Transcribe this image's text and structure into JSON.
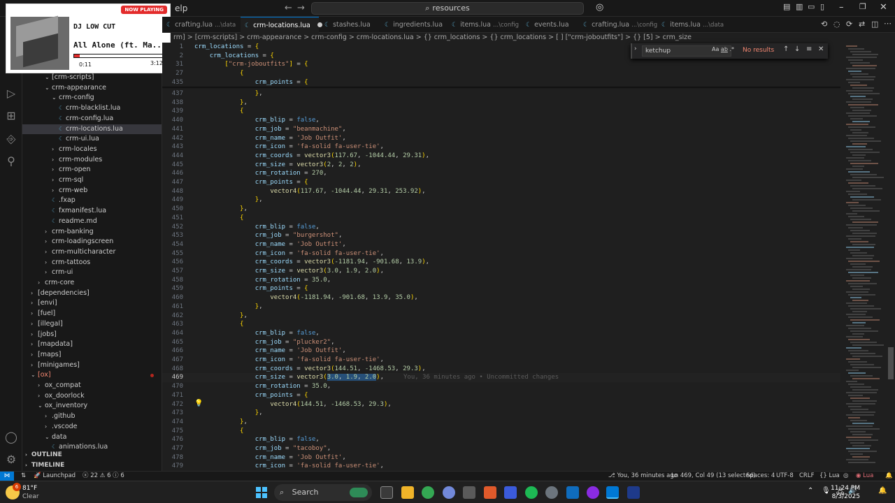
{
  "title_bar": {
    "menu_text": "elp",
    "command_center": "resources"
  },
  "now_playing": {
    "badge": "NOW PLAYING",
    "artist": "DJ LOW CUT",
    "song": "All Alone (ft. Ma...",
    "elapsed": "0:11",
    "duration": "3:12",
    "progress": 0.06
  },
  "tabs": [
    {
      "label": "crafting.lua",
      "desc": "...\\data",
      "active": false
    },
    {
      "label": "crm-locations.lua",
      "desc": "",
      "active": true,
      "modified": true
    },
    {
      "label": "stashes.lua",
      "desc": "",
      "active": false
    },
    {
      "label": "ingredients.lua",
      "desc": "",
      "active": false
    },
    {
      "label": "items.lua",
      "desc": "...\\config",
      "active": false
    },
    {
      "label": "events.lua",
      "desc": "",
      "active": false
    },
    {
      "label": "crafting.lua",
      "desc": "...\\config",
      "active": false
    },
    {
      "label": "items.lua",
      "desc": "...\\data",
      "active": false
    }
  ],
  "breadcrumb": "rm] > [crm-scripts] > crm-appearance > crm-config > crm-locations.lua > {} crm_locations > {} crm_locations > [ ] [\"crm-joboutfits\"] > {} [5] > crm_size",
  "find_widget": {
    "query": "ketchup",
    "result": "No results"
  },
  "explorer": {
    "items": [
      {
        "label": "[crm-scripts]",
        "indent": 2,
        "type": "folder",
        "open": true
      },
      {
        "label": "crm-appearance",
        "indent": 2,
        "type": "folder",
        "open": true
      },
      {
        "label": "crm-config",
        "indent": 3,
        "type": "folder",
        "open": true
      },
      {
        "label": "crm-blacklist.lua",
        "indent": 4,
        "type": "file"
      },
      {
        "label": "crm-config.lua",
        "indent": 4,
        "type": "file"
      },
      {
        "label": "crm-locations.lua",
        "indent": 4,
        "type": "file",
        "selected": true
      },
      {
        "label": "crm-ui.lua",
        "indent": 4,
        "type": "file"
      },
      {
        "label": "crm-locales",
        "indent": 3,
        "type": "folder"
      },
      {
        "label": "crm-modules",
        "indent": 3,
        "type": "folder"
      },
      {
        "label": "crm-open",
        "indent": 3,
        "type": "folder"
      },
      {
        "label": "crm-sql",
        "indent": 3,
        "type": "folder"
      },
      {
        "label": "crm-web",
        "indent": 3,
        "type": "folder"
      },
      {
        "label": ".fxap",
        "indent": 3,
        "type": "file"
      },
      {
        "label": "fxmanifest.lua",
        "indent": 3,
        "type": "file"
      },
      {
        "label": "readme.md",
        "indent": 3,
        "type": "file"
      },
      {
        "label": "crm-banking",
        "indent": 2,
        "type": "folder"
      },
      {
        "label": "crm-loadingscreen",
        "indent": 2,
        "type": "folder"
      },
      {
        "label": "crm-multicharacter",
        "indent": 2,
        "type": "folder"
      },
      {
        "label": "crm-tattoos",
        "indent": 2,
        "type": "folder"
      },
      {
        "label": "crm-ui",
        "indent": 2,
        "type": "folder"
      },
      {
        "label": "crm-core",
        "indent": 1,
        "type": "folder"
      },
      {
        "label": "[dependencies]",
        "indent": 0,
        "type": "folder"
      },
      {
        "label": "[envi]",
        "indent": 0,
        "type": "folder"
      },
      {
        "label": "[fuel]",
        "indent": 0,
        "type": "folder"
      },
      {
        "label": "[illegal]",
        "indent": 0,
        "type": "folder"
      },
      {
        "label": "[jobs]",
        "indent": 0,
        "type": "folder"
      },
      {
        "label": "[mapdata]",
        "indent": 0,
        "type": "folder"
      },
      {
        "label": "[maps]",
        "indent": 0,
        "type": "folder"
      },
      {
        "label": "[minigames]",
        "indent": 0,
        "type": "folder"
      },
      {
        "label": "[ox]",
        "indent": 0,
        "type": "folder",
        "open": true,
        "red": true
      },
      {
        "label": "ox_compat",
        "indent": 1,
        "type": "folder"
      },
      {
        "label": "ox_doorlock",
        "indent": 1,
        "type": "folder"
      },
      {
        "label": "ox_inventory",
        "indent": 1,
        "type": "folder",
        "open": true
      },
      {
        "label": ".github",
        "indent": 2,
        "type": "folder"
      },
      {
        "label": ".vscode",
        "indent": 2,
        "type": "folder"
      },
      {
        "label": "data",
        "indent": 2,
        "type": "folder",
        "open": true
      },
      {
        "label": "animations.lua",
        "indent": 3,
        "type": "file"
      }
    ],
    "outline": "OUTLINE",
    "timeline": "TIMELINE"
  },
  "sticky_lines": [
    {
      "n": "1",
      "code": "crm_locations = {"
    },
    {
      "n": "2",
      "code": "    crm_locations = {"
    },
    {
      "n": "31",
      "code": "        [\"crm-joboutfits\"] = {"
    },
    {
      "n": "27",
      "code": "            {"
    },
    {
      "n": "435",
      "code": "                crm_points = {"
    }
  ],
  "code_lines": [
    {
      "n": "437",
      "code": "                },"
    },
    {
      "n": "438",
      "code": "            },"
    },
    {
      "n": "439",
      "code": "            {"
    },
    {
      "n": "440",
      "code": "                crm_blip = false,"
    },
    {
      "n": "441",
      "code": "                crm_job = \"beanmachine\","
    },
    {
      "n": "442",
      "code": "                crm_name = 'Job Outfit',"
    },
    {
      "n": "443",
      "code": "                crm_icon = 'fa-solid fa-user-tie',"
    },
    {
      "n": "444",
      "code": "                crm_coords = vector3(117.67, -1044.44, 29.31),"
    },
    {
      "n": "445",
      "code": "                crm_size = vector3(2, 2, 2),"
    },
    {
      "n": "446",
      "code": "                crm_rotation = 270,"
    },
    {
      "n": "447",
      "code": "                crm_points = {"
    },
    {
      "n": "448",
      "code": "                    vector4(117.67, -1044.44, 29.31, 253.92),"
    },
    {
      "n": "449",
      "code": "                },"
    },
    {
      "n": "450",
      "code": "            },"
    },
    {
      "n": "451",
      "code": "            {"
    },
    {
      "n": "452",
      "code": "                crm_blip = false,"
    },
    {
      "n": "453",
      "code": "                crm_job = \"burgershot\","
    },
    {
      "n": "454",
      "code": "                crm_name = 'Job Outfit',"
    },
    {
      "n": "455",
      "code": "                crm_icon = 'fa-solid fa-user-tie',"
    },
    {
      "n": "456",
      "code": "                crm_coords = vector3(-1181.94, -901.68, 13.9),"
    },
    {
      "n": "457",
      "code": "                crm_size = vector3(3.0, 1.9, 2.0),"
    },
    {
      "n": "458",
      "code": "                crm_rotation = 35.0,"
    },
    {
      "n": "459",
      "code": "                crm_points = {"
    },
    {
      "n": "460",
      "code": "                    vector4(-1181.94, -901.68, 13.9, 35.0),"
    },
    {
      "n": "461",
      "code": "                },"
    },
    {
      "n": "462",
      "code": "            },"
    },
    {
      "n": "463",
      "code": "            {"
    },
    {
      "n": "464",
      "code": "                crm_blip = false,"
    },
    {
      "n": "465",
      "code": "                crm_job = \"plucker2\","
    },
    {
      "n": "466",
      "code": "                crm_name = 'Job Outfit',"
    },
    {
      "n": "467",
      "code": "                crm_icon = 'fa-solid fa-user-tie',"
    },
    {
      "n": "468",
      "code": "                crm_coords = vector3(144.51, -1468.53, 29.3),"
    },
    {
      "n": "469",
      "code": "                crm_size = vector3(3.0, 1.9, 2.0),",
      "current": true,
      "blame": "You, 36 minutes ago • Uncommitted changes"
    },
    {
      "n": "470",
      "code": "                crm_rotation = 35.0,"
    },
    {
      "n": "471",
      "code": "                crm_points = {"
    },
    {
      "n": "472",
      "code": "                    vector4(144.51, -1468.53, 29.3),",
      "bulb": true
    },
    {
      "n": "473",
      "code": "                },"
    },
    {
      "n": "474",
      "code": "            },"
    },
    {
      "n": "475",
      "code": "            {"
    },
    {
      "n": "476",
      "code": "                crm_blip = false,"
    },
    {
      "n": "477",
      "code": "                crm_job = \"tacoboy\","
    },
    {
      "n": "478",
      "code": "                crm_name = 'Job Outfit',"
    },
    {
      "n": "479",
      "code": "                crm_icon = 'fa-solid fa-user-tie',"
    }
  ],
  "status_bar": {
    "launchpad": "Launchpad",
    "problems_errors": "22",
    "problems_warnings": "6",
    "problems_info": "6",
    "blame": "You, 36 minutes ago",
    "position": "Ln 469, Col 49 (13 selected)",
    "spaces": "Spaces: 4",
    "encoding": "UTF-8",
    "eol": "CRLF",
    "language": "Lua",
    "language_badge": "Lua"
  },
  "taskbar": {
    "temperature": "81°F",
    "weather": "Clear",
    "notification_count": "6",
    "search_label": "Search",
    "time": "11:24 PM",
    "date": "8/3/2025"
  }
}
